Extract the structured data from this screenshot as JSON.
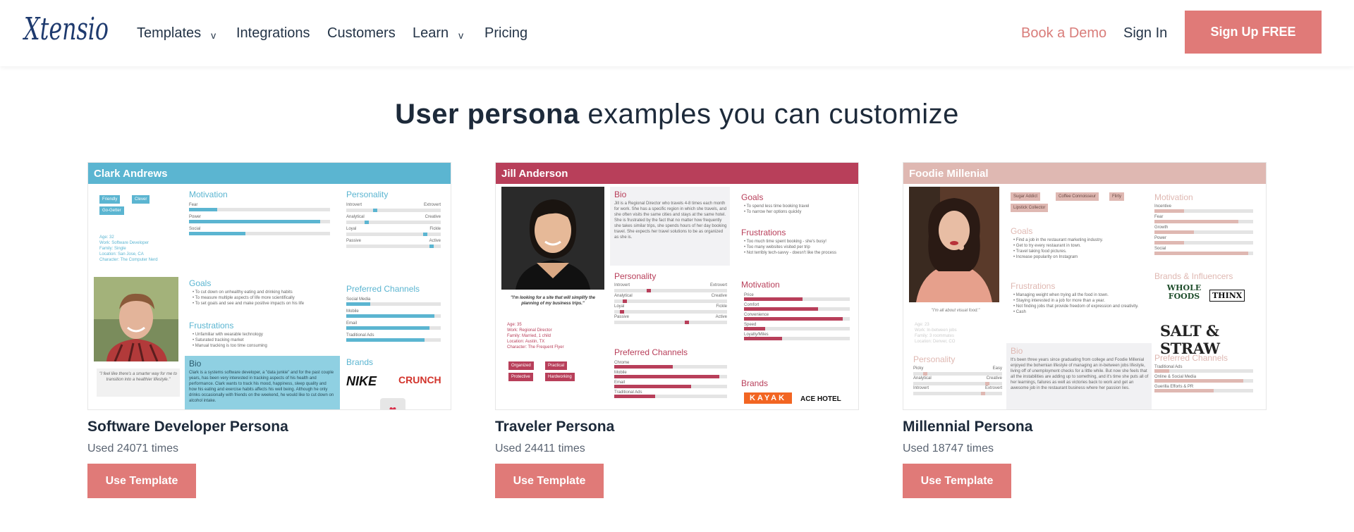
{
  "nav": {
    "logo_text": "Xtensio",
    "items": [
      {
        "label": "Templates",
        "dropdown": true
      },
      {
        "label": "Integrations",
        "dropdown": false
      },
      {
        "label": "Customers",
        "dropdown": false
      },
      {
        "label": "Learn",
        "dropdown": true
      },
      {
        "label": "Pricing",
        "dropdown": false
      }
    ],
    "book_demo": "Book a Demo",
    "sign_in": "Sign In",
    "signup": "Sign Up FREE",
    "chevron": "v"
  },
  "heading": {
    "bold": "User persona",
    "rest": " examples you can customize"
  },
  "cards": [
    {
      "title": "Software Developer Persona",
      "used": "Used 24071 times",
      "button": "Use Template",
      "preview": {
        "name": "Clark Andrews",
        "accent": "#5bb5d1",
        "tags": [
          "Friendly",
          "Clever",
          "Go-Getter"
        ],
        "info": [
          "Age: 32",
          "Work: Software Developer",
          "Family: Single",
          "Location: San Jose, CA",
          "Character: The Computer Nerd"
        ],
        "quote": "\"I feel like there's a smarter way for me to transition into a healthier lifestyle.\"",
        "motivation_label": "Motivation",
        "motivation": [
          {
            "label": "Fear",
            "value": 0.2
          },
          {
            "label": "Power",
            "value": 0.93
          },
          {
            "label": "Social",
            "value": 0.4
          }
        ],
        "goals_label": "Goals",
        "goals": [
          "To cut down on unhealthy eating and drinking habits",
          "To measure multiple aspects of life more scientifically",
          "To set goals and see and make positive impacts on his life"
        ],
        "frustrations_label": "Frustrations",
        "frustrations": [
          "Unfamiliar with wearable technology",
          "Saturated tracking market",
          "Manual tracking is too time consuming"
        ],
        "bio_label": "Bio",
        "bio": "Clark is a systems software developer, a \"data junkie\" and for the past couple years, has been very interested in tracking aspects of his health and performance. Clark wants to track his mood, happiness, sleep quality and how his eating and exercise habits affects his well being. Although he only drinks occasionally with friends on the weekend, he would like to cut down on alcohol intake.",
        "personality_label": "Personality",
        "personality": [
          {
            "left": "Introvert",
            "right": "Extrovert",
            "value": 0.3
          },
          {
            "left": "Analytical",
            "right": "Creative",
            "value": 0.2
          },
          {
            "left": "Loyal",
            "right": "Fickle",
            "value": 0.85
          },
          {
            "left": "Passive",
            "right": "Active",
            "value": 0.92
          }
        ],
        "channels_label": "Preferred Channels",
        "channels": [
          {
            "label": "Social Media",
            "value": 0.25
          },
          {
            "label": "Mobile",
            "value": 0.93
          },
          {
            "label": "Email",
            "value": 0.88
          },
          {
            "label": "Traditional Ads",
            "value": 0.83
          }
        ],
        "brands_label": "Brands",
        "brands": [
          "NIKE",
          "CRUNCH"
        ]
      }
    },
    {
      "title": "Traveler Persona",
      "used": "Used 24411 times",
      "button": "Use Template",
      "preview": {
        "name": "Jill Anderson",
        "accent": "#b83f5a",
        "quote": "\"I'm looking for a site that will simplify the planning of my business trips.\"",
        "info": [
          "Age: 35",
          "Work: Regional Director",
          "Family: Married, 1 child",
          "Location: Austin, TX",
          "Character: The Frequent Flyer"
        ],
        "tags": [
          "Organized",
          "Practical",
          "Protective",
          "Hardworking"
        ],
        "bio_label": "Bio",
        "bio": "Jill is a Regional Director who travels 4-8 times each month for work. She has a specific region in which she travels, and she often visits the same cities and stays at the same hotel. She is frustrated by the fact that no matter how frequently she takes similar trips, she spends hours of her day booking travel. She expects her travel solutions to be as organized as she is.",
        "personality_label": "Personality",
        "personality": [
          {
            "left": "Introvert",
            "right": "Extrovert",
            "value": 0.3
          },
          {
            "left": "Analytical",
            "right": "Creative",
            "value": 0.08
          },
          {
            "left": "Loyal",
            "right": "Fickle",
            "value": 0.05
          },
          {
            "left": "Passive",
            "right": "Active",
            "value": 0.65
          }
        ],
        "channels_label": "Preferred Channels",
        "channels": [
          {
            "label": "Chrome",
            "value": 0.52
          },
          {
            "label": "Mobile",
            "value": 0.93
          },
          {
            "label": "Email",
            "value": 0.68
          },
          {
            "label": "Traditional Ads",
            "value": 0.36
          }
        ],
        "goals_label": "Goals",
        "goals": [
          "To spend less time booking travel",
          "To narrow her options quickly"
        ],
        "frustrations_label": "Frustrations",
        "frustrations": [
          "Too much time spent booking - she's busy!",
          "Too many websites visited per trip",
          "Not terribly tech-savvy - doesn't like the process"
        ],
        "motivation_label": "Motivation",
        "motivation": [
          {
            "label": "Price",
            "value": 0.55
          },
          {
            "label": "Comfort",
            "value": 0.7
          },
          {
            "label": "Convenience",
            "value": 0.93
          },
          {
            "label": "Speed",
            "value": 0.2
          },
          {
            "label": "Loyalty/Miles",
            "value": 0.36
          }
        ],
        "brands_label": "Brands",
        "brands": [
          "KAYAK",
          "ACE HOTEL"
        ]
      }
    },
    {
      "title": "Millennial Persona",
      "used": "Used 18747 times",
      "button": "Use Template",
      "preview": {
        "name": "Foodie Millenial",
        "accent": "#dfb8b2",
        "quote": "\"I'm all about visual food.\"",
        "info": [
          "Age: 23",
          "Work: In-between jobs",
          "Family: 3 roommates",
          "Location: Denver, CO"
        ],
        "tags": [
          "Sugar Addict",
          "Coffee Connoisseur",
          "Flirty",
          "Lipstick Collector"
        ],
        "goals_label": "Goals",
        "goals": [
          "Find a job in the restaurant marketing industry.",
          "Get to try every restaurant in town.",
          "Travel taking food pictures.",
          "Increase popularity on Instagram"
        ],
        "frustrations_label": "Frustrations",
        "frustrations": [
          "Managing weight when trying all the food in town.",
          "Staying interested in a job for more than a year.",
          "Not finding jobs that provide freedom of expression and creativity.",
          "Cash"
        ],
        "bio_label": "Bio",
        "bio": "It's been three years since graduating from college and Foodie Millenial enjoyed the bohemian lifestyle of managing an in-between jobs lifestyle, living off of unemployment checks for a little while. But now she feels that all the instabilities are adding up to something, and it's time she puts all of her learnings, failures as well as victories back to work and get an awesome job in the restaurant business where her passion lies.",
        "personality_label": "Personality",
        "personality": [
          {
            "left": "Picky",
            "right": "Easy",
            "value": 0.12
          },
          {
            "left": "Analytical",
            "right": "Creative",
            "value": 0.85
          },
          {
            "left": "Introvert",
            "right": "Extrovert",
            "value": 0.8
          }
        ],
        "motivation_label": "Motivation",
        "motivation": [
          {
            "label": "Incentive",
            "value": 0.3
          },
          {
            "label": "Fear",
            "value": 0.85
          },
          {
            "label": "Growth",
            "value": 0.4
          },
          {
            "label": "Power",
            "value": 0.3
          },
          {
            "label": "Social",
            "value": 0.95
          }
        ],
        "brands_label": "Brands & Influencers",
        "brands": [
          "WHOLE FOODS",
          "THINX",
          "SALT & STRAW"
        ],
        "channels_label": "Preferred Channels",
        "channels": [
          {
            "label": "Traditional Ads",
            "value": 0.15
          },
          {
            "label": "Online & Social Media",
            "value": 0.9
          },
          {
            "label": "Guerilla Efforts & PR",
            "value": 0.6
          }
        ]
      }
    }
  ]
}
